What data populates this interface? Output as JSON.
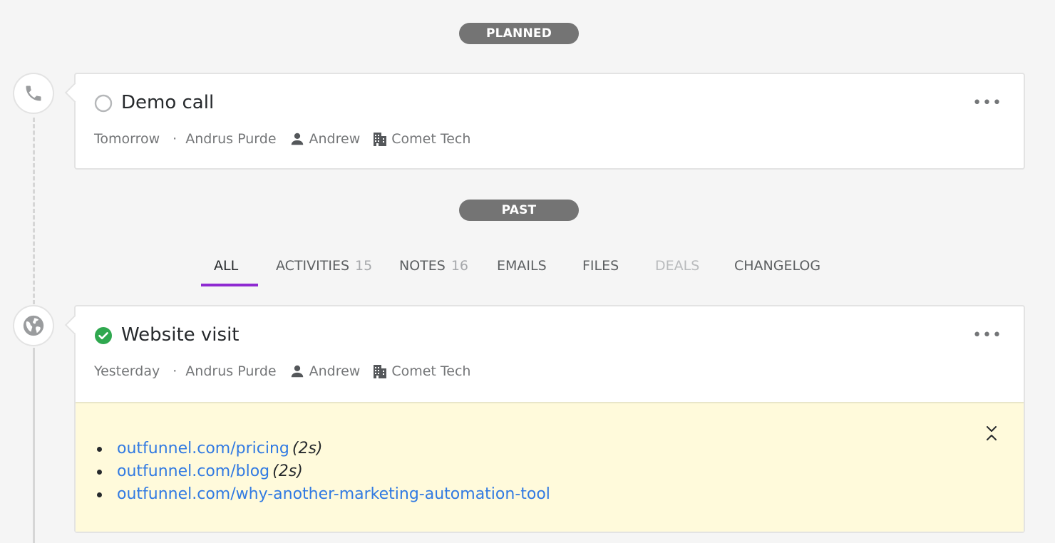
{
  "sections": {
    "planned_label": "PLANNED",
    "past_label": "PAST"
  },
  "planned_activity": {
    "title": "Demo call",
    "type_icon": "phone-icon",
    "status_icon": "circle-outline-icon",
    "date": "Tomorrow",
    "separator": "·",
    "owner": "Andrus Purde",
    "person": "Andrew",
    "organization": "Comet Tech",
    "more_label": "•••"
  },
  "tabs": [
    {
      "label": "ALL",
      "count": "",
      "active": true
    },
    {
      "label": "ACTIVITIES",
      "count": "15"
    },
    {
      "label": "NOTES",
      "count": "16"
    },
    {
      "label": "EMAILS",
      "count": ""
    },
    {
      "label": "FILES",
      "count": ""
    },
    {
      "label": "DEALS",
      "count": "",
      "disabled": true
    },
    {
      "label": "CHANGELOG",
      "count": ""
    }
  ],
  "past_activity": {
    "title": "Website visit",
    "type_icon": "globe-icon",
    "status_icon": "check-circle-icon",
    "date": "Yesterday",
    "separator": "·",
    "owner": "Andrus Purde",
    "person": "Andrew",
    "organization": "Comet Tech",
    "more_label": "•••",
    "visits": [
      {
        "url": "outfunnel.com/pricing",
        "duration": "(2s)"
      },
      {
        "url": "outfunnel.com/blog",
        "duration": "(2s)"
      },
      {
        "url": "outfunnel.com/why-another-marketing-automation-tool",
        "duration": ""
      }
    ]
  },
  "colors": {
    "accent": "#8e2ad1",
    "done": "#2fa84f",
    "link": "#317ae2",
    "note_bg": "#fffadb",
    "pill_bg": "#747474"
  }
}
